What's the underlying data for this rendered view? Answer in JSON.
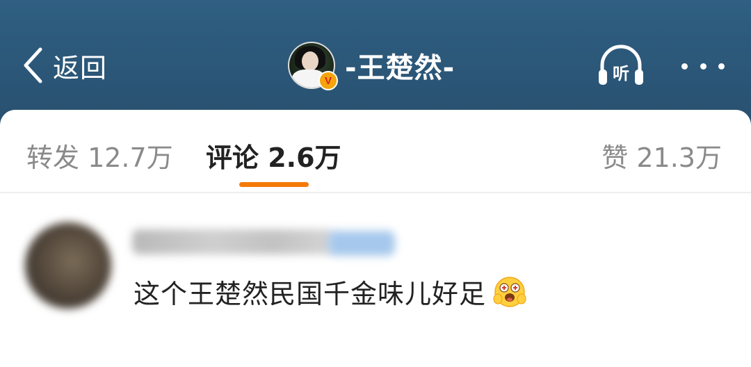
{
  "header": {
    "back_label": "返回",
    "title": "-王楚然-",
    "verified_mark": "V",
    "listen_label": "听",
    "icons": [
      "chevron-left-icon",
      "verified-icon",
      "headphones-icon",
      "more-icon"
    ]
  },
  "tabs": {
    "repost": "转发 12.7万",
    "comment": "评论 2.6万",
    "like": "赞 21.3万",
    "active": "comment",
    "accent_color": "#f47a08"
  },
  "comment": {
    "text": "这个王楚然民国千金味儿好足",
    "emoji": "hugging-face-emoji"
  },
  "colors": {
    "header_bg": "#2b5677",
    "accent": "#f47a08"
  }
}
